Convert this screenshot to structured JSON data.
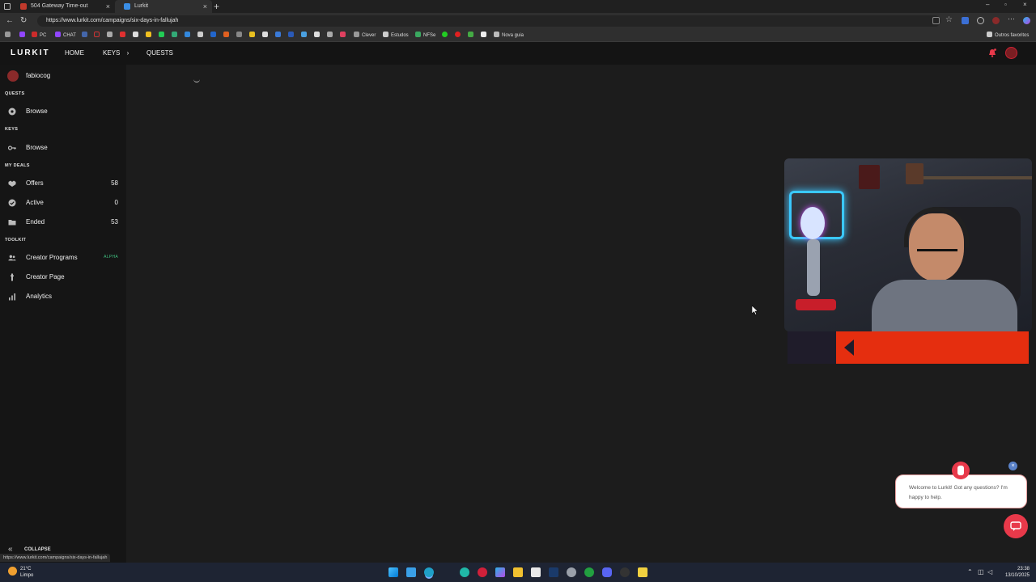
{
  "browser": {
    "tabs": [
      {
        "label": "504 Gateway Time-out",
        "active": false
      },
      {
        "label": "Lurkit",
        "active": true
      }
    ],
    "url": "https://www.lurkit.com/campaigns/six-days-in-fallujah",
    "bookmarks": [
      "PC",
      "CHAT",
      "Clever",
      "Estudos",
      "NFSe",
      "Nova guia"
    ],
    "bookmarks_right": "Outros favoritos",
    "status_url": "https://www.lurkit.com/campaigns/six-days-in-fallujah"
  },
  "header": {
    "logo": "LURKIT",
    "nav": [
      "HOME",
      "KEYS",
      "QUESTS"
    ],
    "keys_chevron": "›"
  },
  "sidebar": {
    "username": "fabiocog",
    "sections": {
      "quests": "QUESTS",
      "keys": "KEYS",
      "my_deals": "MY DEALS",
      "toolkit": "TOOLKIT"
    },
    "quests_browse": "Browse",
    "keys_browse": "Browse",
    "deals": [
      {
        "label": "Offers",
        "count": "58"
      },
      {
        "label": "Active",
        "count": "0"
      },
      {
        "label": "Ended",
        "count": "53"
      }
    ],
    "toolkit": [
      {
        "label": "Creator Programs",
        "badge": "ALPHA"
      },
      {
        "label": "Creator Page"
      },
      {
        "label": "Analytics"
      }
    ],
    "collapse": "COLLAPSE"
  },
  "chat": {
    "message": "Welcome to Lurkit! Got any questions? I'm happy to help.",
    "close": "×"
  },
  "taskbar": {
    "temp": "21°C",
    "condition": "Limpo",
    "time": "23:38",
    "date": "13/10/2025"
  },
  "colors": {
    "accent_red": "#e8394a",
    "banner_red": "#e52e0f",
    "alpha_green": "#3fbf7f",
    "sidebar_bg": "#151515",
    "main_bg": "#1c1c1c"
  }
}
